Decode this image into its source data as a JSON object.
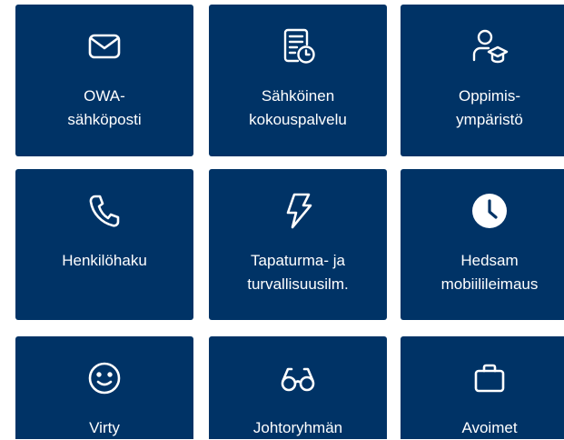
{
  "tiles": [
    {
      "label": "OWA-\nsähköposti",
      "icon": "mail-icon"
    },
    {
      "label": "Sähköinen\nkokouspalvelu",
      "icon": "document-clock-icon"
    },
    {
      "label": "Oppimis-\nympäristö",
      "icon": "student-icon"
    },
    {
      "label": "Henkilöhaku",
      "icon": "phone-icon"
    },
    {
      "label": "Tapaturma- ja\nturvallisuusilm.",
      "icon": "lightning-icon"
    },
    {
      "label": "Hedsam\nmobiilileimaus",
      "icon": "clock-icon"
    },
    {
      "label": "Virty",
      "icon": "smiley-icon"
    },
    {
      "label": "Johtoryhmän",
      "icon": "glasses-icon"
    },
    {
      "label": "Avoimet",
      "icon": "briefcase-icon"
    }
  ],
  "colors": {
    "tile_bg": "#003366",
    "text": "#ffffff"
  }
}
